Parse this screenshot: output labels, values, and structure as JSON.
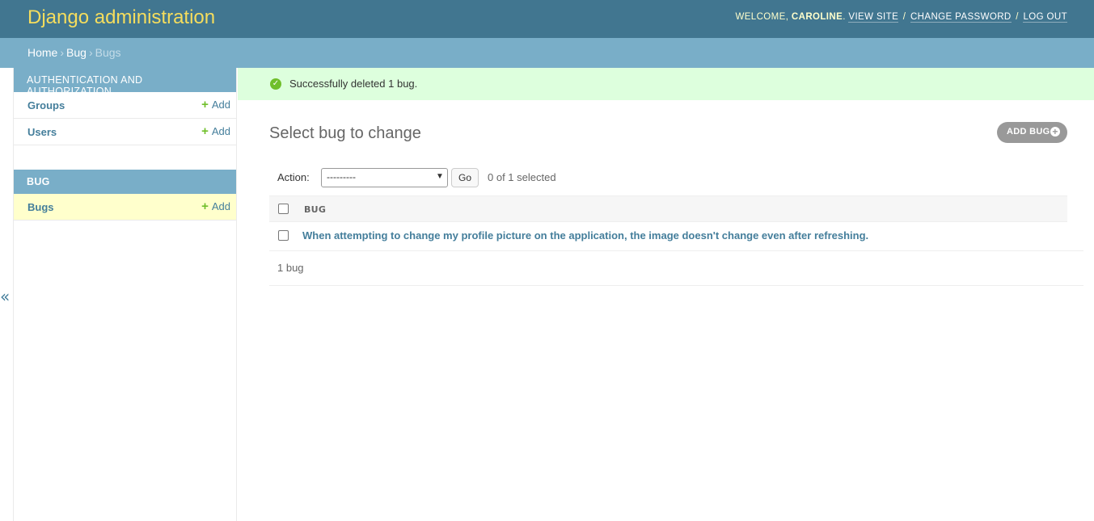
{
  "header": {
    "branding": "Django administration",
    "welcome": "Welcome,",
    "username": "Caroline",
    "view_site": "View site",
    "change_password": "Change password",
    "log_out": "Log out",
    "separator": "/"
  },
  "breadcrumbs": {
    "items": [
      "Home",
      "Bug",
      "Bugs"
    ],
    "separator": "›"
  },
  "sidebar": {
    "toggle_glyph": "«",
    "add_label": "Add",
    "modules": [
      {
        "caption": "Authentication and Authorization",
        "models": [
          {
            "name": "Groups"
          },
          {
            "name": "Users"
          }
        ]
      },
      {
        "caption": "Bug",
        "models": [
          {
            "name": "Bugs",
            "current": true
          }
        ]
      }
    ]
  },
  "message": {
    "type": "success",
    "text": "Successfully deleted 1 bug."
  },
  "content": {
    "title": "Select bug to change",
    "add_button": "Add bug",
    "actions": {
      "label": "Action:",
      "selected_option": "---------",
      "go_label": "Go",
      "counter": "0 of 1 selected"
    },
    "table": {
      "column_header": "Bug",
      "rows": [
        "When attempting to change my profile picture on the application, the image doesn't change even after refreshing."
      ]
    },
    "paginator": "1 bug"
  },
  "colors": {
    "header_bg": "#417690",
    "branding": "#f5dd5d",
    "breadcrumbs_bg": "#79aec8",
    "link": "#447e9b",
    "success_bg": "#ddffdd",
    "add_green": "#70bf2b",
    "current_row_bg": "#ffffcc"
  }
}
